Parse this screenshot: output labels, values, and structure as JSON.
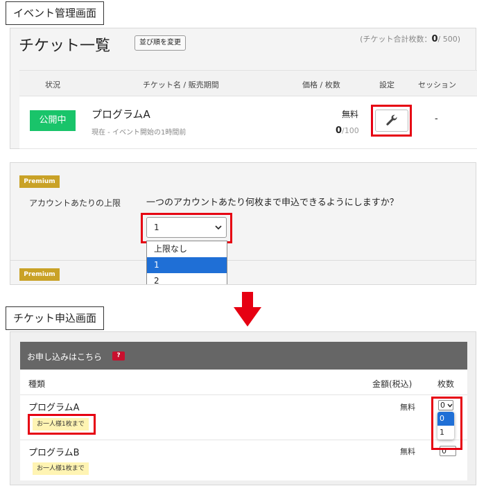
{
  "labels": {
    "admin": "イベント管理画面",
    "apply": "チケット申込画面"
  },
  "admin_panel": {
    "title": "チケット一覧",
    "sort_button": "並び順を変更",
    "total_prefix": "(チケット合計枚数：",
    "total_count": "0",
    "total_suffix": "/ 500)",
    "columns": [
      "状況",
      "チケット名 / 販売期間",
      "価格 / 枚数",
      "設定",
      "セッション"
    ],
    "ticket": {
      "status": "公開中",
      "name": "プログラムA",
      "period": "現在 - イベント開始の1時間前",
      "price": "無料",
      "sold": "0",
      "capacity": "/100",
      "session": "-"
    }
  },
  "settings_panel": {
    "premium_badge": "Premium",
    "field_label": "アカウントあたりの上限",
    "question": "一つのアカウントあたり何枚まで申込できるようにしますか？",
    "selected_value": "1",
    "options": [
      "上限なし",
      "1",
      "2"
    ],
    "highlighted_option": "1"
  },
  "apply_panel": {
    "header": "お申し込みはこちら",
    "help_icon": "?",
    "col_type": "種類",
    "col_amount": "金額(税込)",
    "col_qty": "枚数",
    "rows": [
      {
        "name": "プログラムA",
        "tag": "お一人様1枚まで",
        "price": "無料",
        "qty": "0"
      },
      {
        "name": "プログラムB",
        "tag": "お一人様1枚まで",
        "price": "無料",
        "qty": "0"
      }
    ],
    "qty_options": [
      "0",
      "1"
    ]
  },
  "colors": {
    "highlight_red": "#e60012",
    "status_green": "#19c46a",
    "premium_gold": "#c9a227",
    "select_blue": "#1f6fd6"
  },
  "icons": [
    "wrench-icon",
    "chevron-down-icon",
    "down-arrow-icon",
    "help-icon"
  ]
}
